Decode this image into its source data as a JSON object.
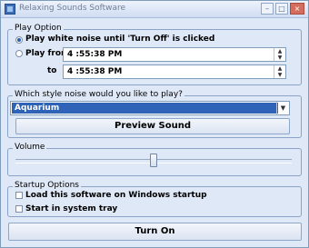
{
  "window": {
    "title": "Relaxing Sounds Software",
    "min_glyph": "–",
    "max_glyph": "□",
    "close_glyph": "×"
  },
  "play_option": {
    "group_label": "Play Option",
    "option_until_off": "Play white noise until 'Turn Off' is clicked",
    "option_play_from": "Play from",
    "from_time": "4 :55:38 PM",
    "to_label": "to",
    "to_time": "4 :55:38 PM",
    "selected": "until_off"
  },
  "noise_style": {
    "group_label": "Which style noise would you like to play?",
    "selected": "Aquarium",
    "preview_button": "Preview Sound"
  },
  "volume": {
    "group_label": "Volume",
    "level_fraction": 0.5
  },
  "startup": {
    "group_label": "Startup Options",
    "load_on_startup": "Load this software on Windows startup",
    "start_in_tray": "Start in system tray",
    "load_on_startup_checked": false,
    "start_in_tray_checked": false
  },
  "turn_on_button": "Turn On",
  "icons": {
    "spin_up": "▲",
    "spin_down": "▼",
    "dropdown": "▼"
  }
}
